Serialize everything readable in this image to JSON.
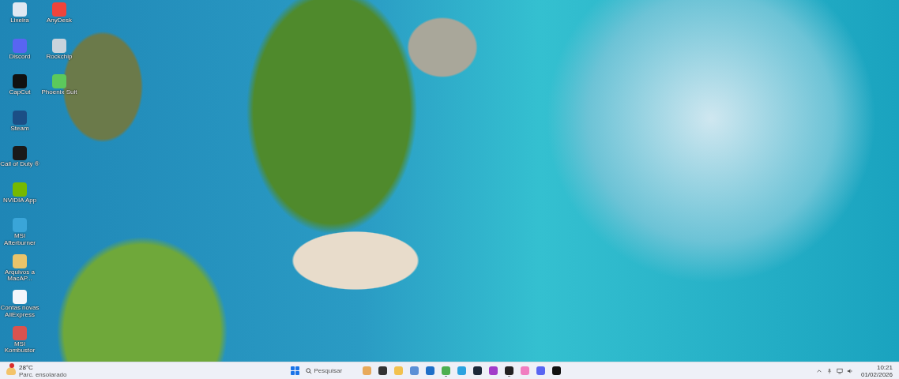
{
  "desktop": {
    "icons": [
      {
        "label": "Lixeira",
        "color": "#dfe8f2"
      },
      {
        "label": "Discord",
        "color": "#5865f2"
      },
      {
        "label": "CapCut",
        "color": "#111111"
      },
      {
        "label": "Steam",
        "color": "#1b4f86"
      },
      {
        "label": "Call of Duty ®",
        "color": "#1a1a1a"
      },
      {
        "label": "NVIDIA App",
        "color": "#76b900"
      },
      {
        "label": "MSI Afterburner",
        "color": "#3aa5d8"
      },
      {
        "label": "Arquivos a MacAP...",
        "color": "#e9c46a"
      },
      {
        "label": "Contas novas AliExpress",
        "color": "#f4f6fb"
      },
      {
        "label": "MSI Kombustor",
        "color": "#d9534f"
      },
      {
        "label": "AnyDesk",
        "color": "#ef443b"
      },
      {
        "label": "Rockchip",
        "color": "#c9d3dc"
      },
      {
        "label": "Phoenix Suit",
        "color": "#5cc95c"
      }
    ]
  },
  "taskbar": {
    "weather": {
      "temperature": "28°C",
      "condition": "Parc. ensolarado",
      "alert": true
    },
    "search": {
      "placeholder": "Pesquisar"
    },
    "apps": [
      {
        "color": "#e8a95a",
        "running": false
      },
      {
        "color": "#333333",
        "running": false
      },
      {
        "color": "#f2c14e",
        "running": false
      },
      {
        "color": "#5b8fd6",
        "running": false
      },
      {
        "color": "#1e6fc8",
        "running": false
      },
      {
        "color": "#4caf50",
        "running": true
      },
      {
        "color": "#2aa3e0",
        "running": false
      },
      {
        "color": "#1b2838",
        "running": false
      },
      {
        "color": "#a23cc9",
        "running": false
      },
      {
        "color": "#222222",
        "running": true
      },
      {
        "color": "#f07dc0",
        "running": false
      },
      {
        "color": "#5865f2",
        "running": false
      },
      {
        "color": "#111111",
        "running": false
      }
    ],
    "clock": {
      "time": "10:21",
      "date": "01/02/2026"
    }
  }
}
